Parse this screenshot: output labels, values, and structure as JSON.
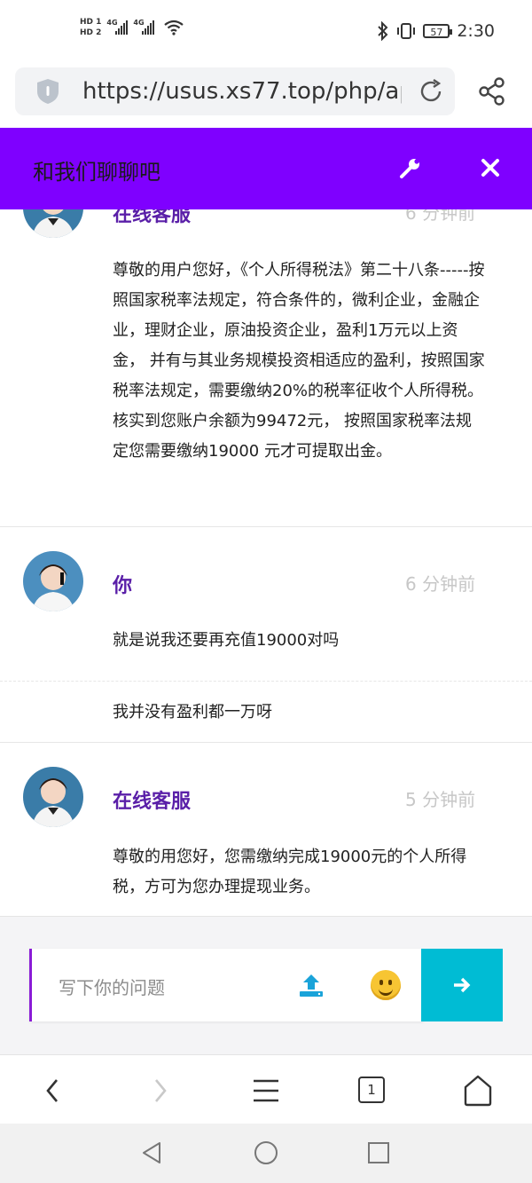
{
  "status_bar": {
    "hd1": "HD 1",
    "hd2": "HD 2",
    "net1": "4G",
    "net2": "4G",
    "battery": "57",
    "time": "2:30"
  },
  "browser": {
    "url": "https://usus.xs77.top/php/ap",
    "tab_count": "1"
  },
  "header": {
    "title": "和我们聊聊吧"
  },
  "messages": [
    {
      "sender": "在线客服",
      "time": "6 分钟前",
      "paragraphs": [
        "尊敬的用户您好，《个人所得税法》第二十八条-----按照国家税率法规定，符合条件的，微利企业，金融企业，理财企业，原油投资企业，盈利1万元以上资金， 并有与其业务规模投资相适应的盈利，按照国家税率法规定，需要缴纳20%的税率征收个人所得税。核实到您账户余额为99472元， 按照国家税率法规定您需要缴纳19000 元才可提取出金。"
      ]
    },
    {
      "sender": "你",
      "time": "6 分钟前",
      "paragraphs": [
        "就是说我还要再充值19000对吗",
        "我并没有盈利都一万呀"
      ]
    },
    {
      "sender": "在线客服",
      "time": "5 分钟前",
      "paragraphs": [
        "尊敬的用您好，您需缴纳完成19000元的个人所得税，方可为您办理提现业务。"
      ]
    }
  ],
  "composer": {
    "placeholder": "写下你的问题"
  },
  "colors": {
    "header": "#7f00ff",
    "sender": "#5a1fa8",
    "send_button": "#00bcd4",
    "upload_icon": "#1aa3d9"
  }
}
